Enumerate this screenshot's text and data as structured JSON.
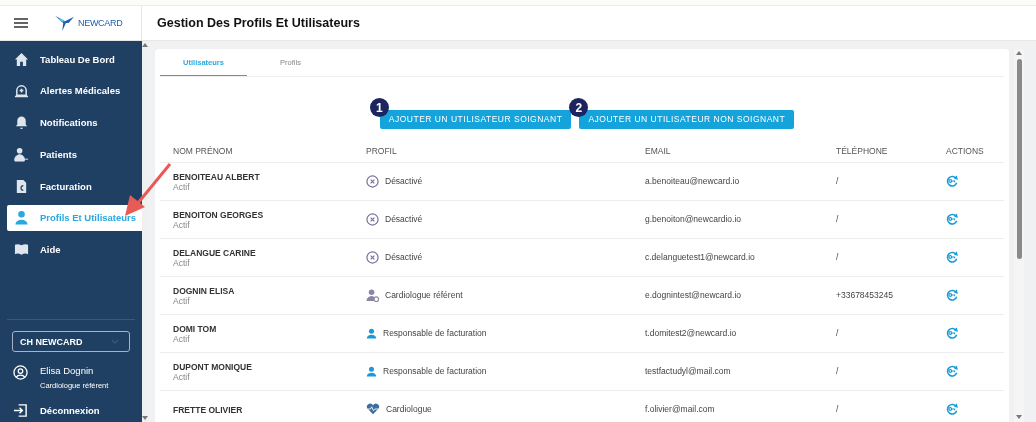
{
  "header": {
    "logo_text": "NEWCARD",
    "title": "Gestion Des Profils Et Utilisateurs"
  },
  "sidebar": {
    "items": [
      {
        "label": "Tableau De Bord",
        "kind": "home",
        "selected": false
      },
      {
        "label": "Alertes Médicales",
        "kind": "alert",
        "selected": false
      },
      {
        "label": "Notifications",
        "kind": "bell",
        "selected": false
      },
      {
        "label": "Patients",
        "kind": "patients",
        "selected": false
      },
      {
        "label": "Facturation",
        "kind": "invoice",
        "selected": false
      },
      {
        "label": "Profils Et Utilisateurs",
        "kind": "user",
        "selected": true
      },
      {
        "label": "Aide",
        "kind": "help",
        "selected": false
      }
    ],
    "establishment": "CH NEWCARD",
    "user": {
      "name": "Elisa Dognin",
      "role": "Cardiologue référent"
    },
    "logout": "Déconnexion"
  },
  "tabs": [
    {
      "label": "Utilisateurs",
      "selected": true
    },
    {
      "label": "Profils",
      "selected": false
    }
  ],
  "buttons": [
    {
      "label": "AJOUTER UN UTILISATEUR SOIGNANT",
      "step": "1"
    },
    {
      "label": "AJOUTER UN UTILISATEUR NON SOIGNANT",
      "step": "2"
    }
  ],
  "table": {
    "columns": [
      "NOM PRÉNOM",
      "PROFIL",
      "EMAIL",
      "TÉLÉPHONE",
      "ACTIONS"
    ],
    "rows": [
      {
        "name": "BENOITEAU ALBERT",
        "status": "Actif",
        "profile": "Désactivé",
        "kind": "disabled",
        "email": "a.benoiteau@newcard.io",
        "phone": "/"
      },
      {
        "name": "BENOITON GEORGES",
        "status": "Actif",
        "profile": "Désactivé",
        "kind": "disabled",
        "email": "g.benoiton@newcardio.io",
        "phone": "/"
      },
      {
        "name": "DELANGUE CARINE",
        "status": "Actif",
        "profile": "Désactivé",
        "kind": "disabled",
        "email": "c.delanguetest1@newcard.io",
        "phone": "/"
      },
      {
        "name": "DOGNIN ELISA",
        "status": "Actif",
        "profile": "Cardiologue référent",
        "kind": "referent",
        "email": "e.dognintest@newcard.io",
        "phone": "+33678453245"
      },
      {
        "name": "DOMI TOM",
        "status": "Actif",
        "profile": "Responsable de facturation",
        "kind": "billing",
        "email": "t.domitest2@newcard.io",
        "phone": "/"
      },
      {
        "name": "DUPONT MONIQUE",
        "status": "Actif",
        "profile": "Responsable de facturation",
        "kind": "billing",
        "email": "testfactudyl@mail.com",
        "phone": "/"
      },
      {
        "name": "FRETTE OLIVIER",
        "profile": "Cardiologue",
        "kind": "cardiologist",
        "email": "f.olivier@mail.com",
        "phone": "/"
      }
    ]
  }
}
